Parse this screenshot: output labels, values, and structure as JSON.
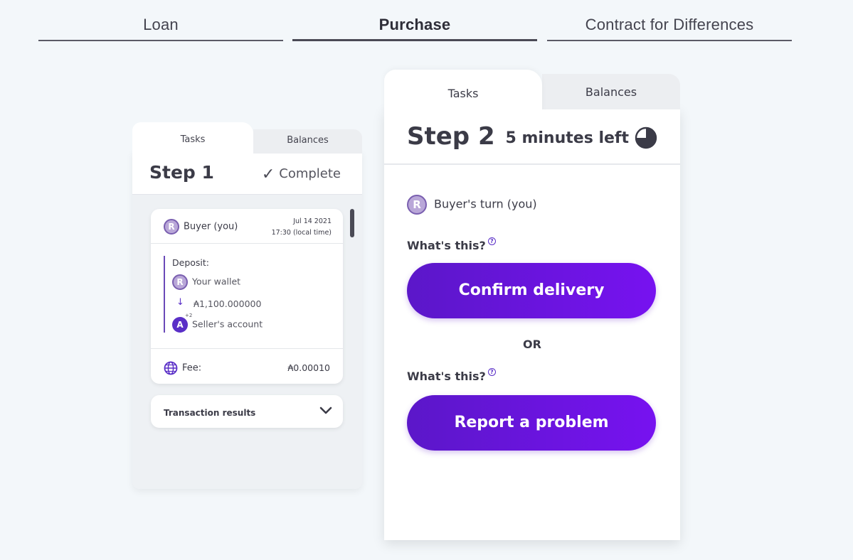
{
  "top_tabs": [
    {
      "label": "Loan",
      "active": false
    },
    {
      "label": "Purchase",
      "active": true
    },
    {
      "label": "Contract for Differences",
      "active": false
    }
  ],
  "step1_card": {
    "tabs": {
      "tasks": "Tasks",
      "balances": "Balances"
    },
    "step_title": "Step 1",
    "status": "Complete",
    "transaction": {
      "actor_initial": "R",
      "actor": "Buyer (you)",
      "date": "Jul 14 2021",
      "time": "17:30 (local time)",
      "deposit_label": "Deposit:",
      "from_initial": "R",
      "from": "Your wallet",
      "amount": "₳1,100.000000",
      "to_initial": "A",
      "to_superscript": "+2",
      "to": "Seller's account",
      "fee_label": "Fee:",
      "fee_value": "₳0.00010"
    },
    "results_label": "Transaction results"
  },
  "step2_card": {
    "tabs": {
      "tasks": "Tasks",
      "balances": "Balances"
    },
    "step_title": "Step 2",
    "time_left": "5 minutes left",
    "turn_initial": "R",
    "turn_label": "Buyer's turn (you)",
    "whats_this_1": "What's this?",
    "confirm_button": "Confirm delivery",
    "or_text": "OR",
    "whats_this_2": "What's this?",
    "report_button": "Report a problem",
    "help_glyph": "?"
  },
  "colors": {
    "accent_start": "#5b17c9",
    "accent_end": "#7712f0",
    "background": "#f3f7fa"
  }
}
